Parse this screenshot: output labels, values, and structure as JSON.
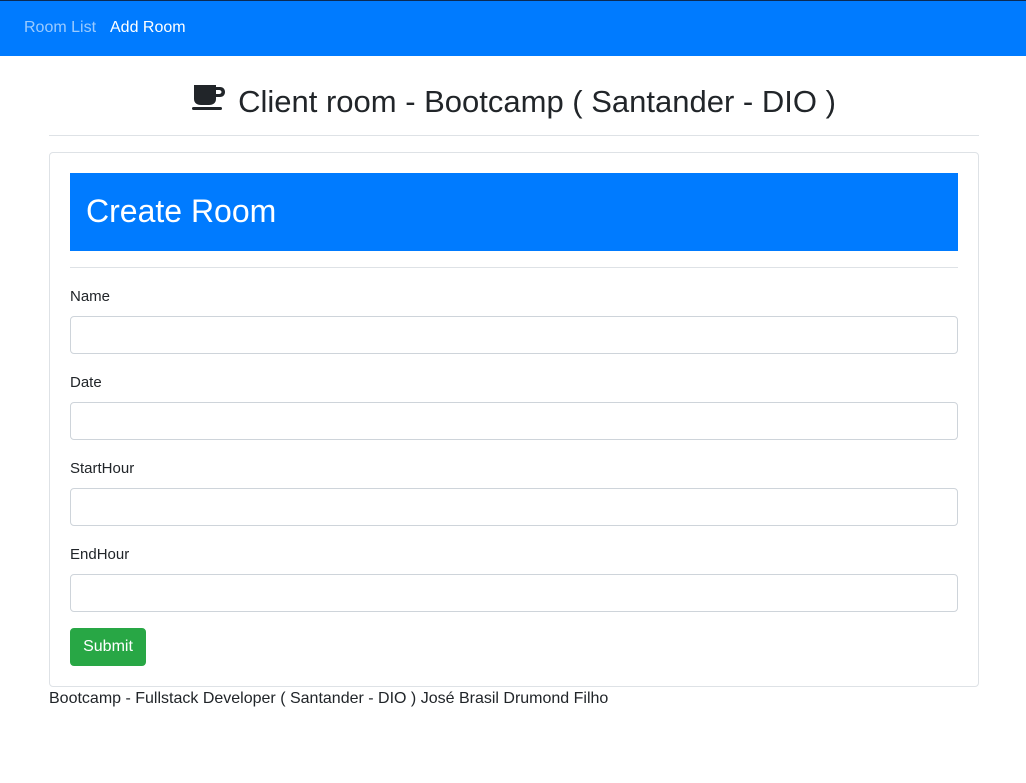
{
  "navbar": {
    "links": [
      {
        "label": "Room List"
      },
      {
        "label": "Add Room"
      }
    ],
    "colors": {
      "background": "#007bff"
    }
  },
  "page": {
    "title": "Client room - Bootcamp ( Santander - DIO )",
    "title_icon": "coffee-cup-icon"
  },
  "form": {
    "header": "Create Room",
    "fields": [
      {
        "label": "Name",
        "value": ""
      },
      {
        "label": "Date",
        "value": ""
      },
      {
        "label": "StartHour",
        "value": ""
      },
      {
        "label": "EndHour",
        "value": ""
      }
    ],
    "submit_label": "Submit",
    "colors": {
      "header": "#007bff",
      "submit": "#28a745"
    }
  },
  "footer": {
    "text": "Bootcamp - Fullstack Developer ( Santander - DIO ) José Brasil Drumond Filho"
  }
}
